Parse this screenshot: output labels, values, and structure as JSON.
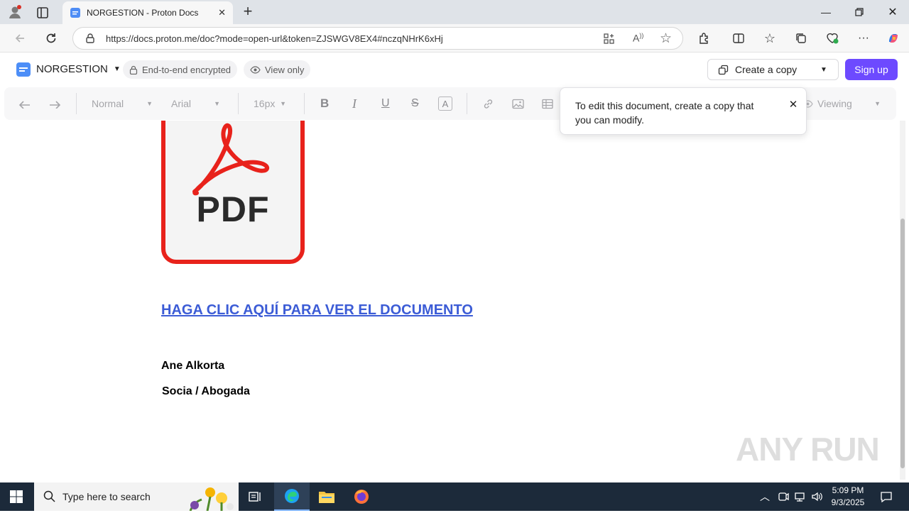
{
  "browser": {
    "tab_title": "NORGESTION - Proton Docs",
    "url": "https://docs.proton.me/doc?mode=open-url&token=ZJSWGV8EX4#nczqNHrK6xHj"
  },
  "app": {
    "doc_name": "NORGESTION",
    "encrypted_label": "End-to-end encrypted",
    "view_only_label": "View only",
    "create_copy_label": "Create a copy",
    "signup_label": "Sign up"
  },
  "toolbar": {
    "style_value": "Normal",
    "font_value": "Arial",
    "size_value": "16px",
    "viewing_label": "Viewing"
  },
  "tooltip": {
    "text": "To edit this document, create a copy that you can modify."
  },
  "document": {
    "pdf_label": "PDF",
    "link_text": "HAGA CLIC AQUÍ PARA VER EL DOCUMENTO",
    "author_name": "Ane Alkorta",
    "author_role": "Socia / Abogada"
  },
  "watermark": "ANY RUN",
  "taskbar": {
    "search_placeholder": "Type here to search",
    "time": "5:09 PM",
    "date": "9/3/2025"
  },
  "colors": {
    "accent": "#6d4aff",
    "link": "#3c5cd6",
    "pdf_red": "#e8221b"
  }
}
